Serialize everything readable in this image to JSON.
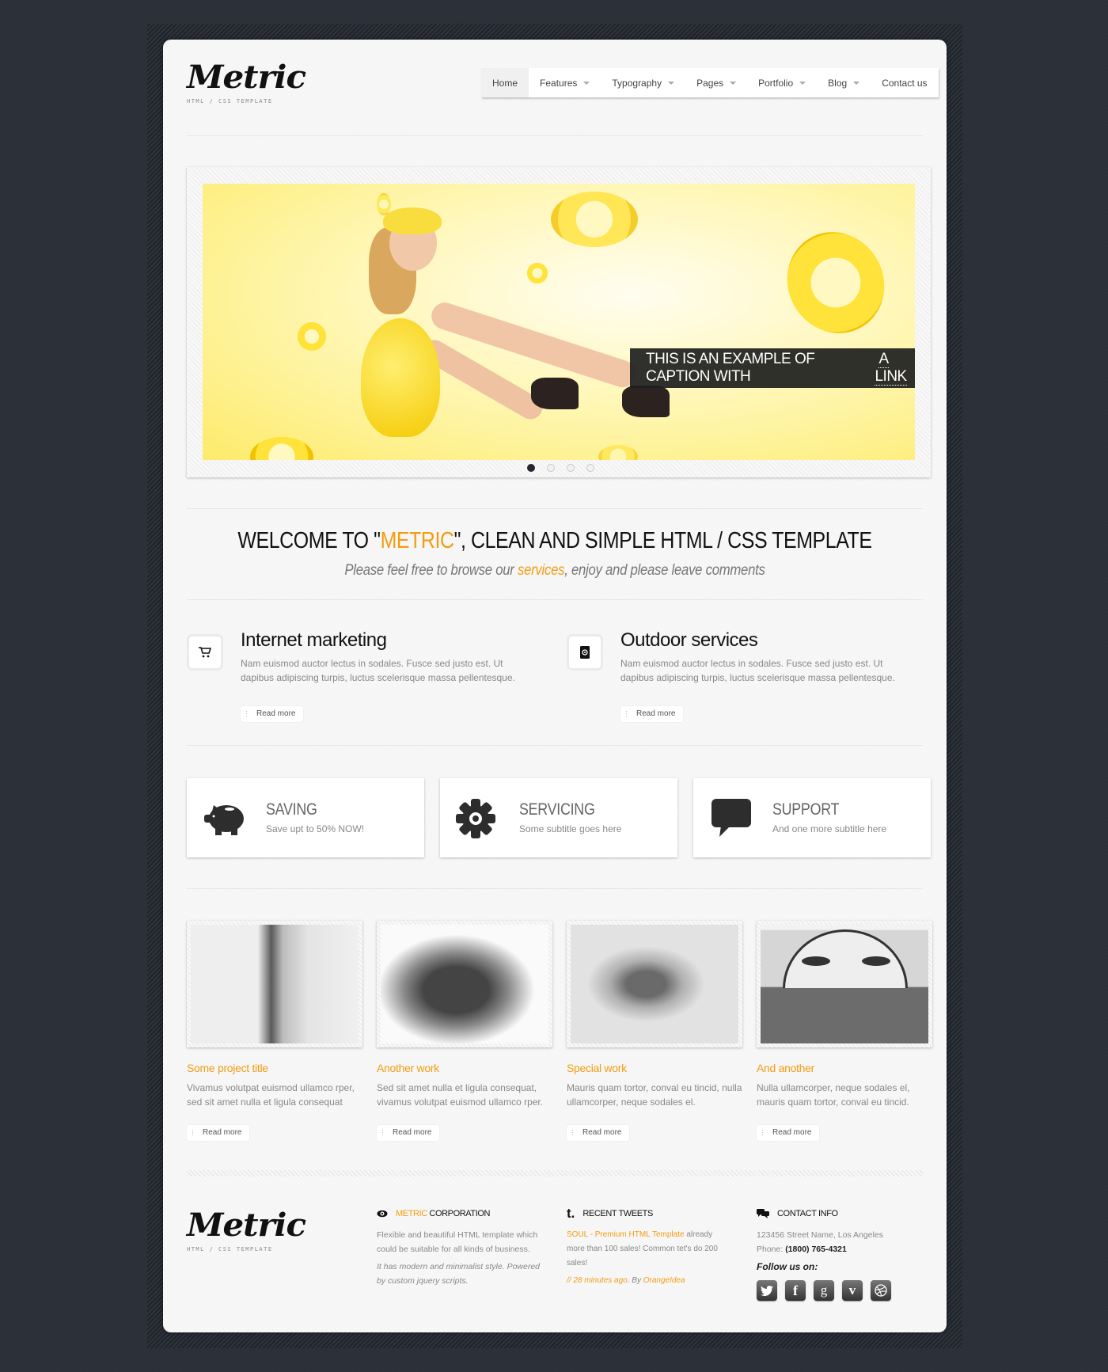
{
  "logo": {
    "title": "Metric",
    "subtitle": "HTML / CSS TEMPLATE"
  },
  "nav": {
    "items": [
      {
        "label": "Home",
        "active": true,
        "dropdown": false
      },
      {
        "label": "Features",
        "dropdown": true
      },
      {
        "label": "Typography",
        "dropdown": true
      },
      {
        "label": "Pages",
        "dropdown": true
      },
      {
        "label": "Portfolio",
        "dropdown": true
      },
      {
        "label": "Blog",
        "dropdown": true
      },
      {
        "label": "Contact us",
        "dropdown": false
      }
    ]
  },
  "slider": {
    "caption_text": "THIS IS AN EXAMPLE OF CAPTION WITH",
    "caption_link": "A LINK",
    "slide_count": 4,
    "active_slide": 1
  },
  "welcome": {
    "title_pre": "WELCOME TO \"",
    "title_highlight": "METRIC",
    "title_post": "\", CLEAN AND SIMPLE HTML / CSS TEMPLATE",
    "subtitle_pre": "Please feel free to browse our ",
    "subtitle_link": "services",
    "subtitle_post": ", enjoy and please leave comments"
  },
  "services": [
    {
      "icon": "shopping-cart-icon",
      "title": "Internet marketing",
      "text": "Nam euismod auctor lectus in sodales. Fusce sed justo est. Ut dapibus adipiscing turpis, luctus scelerisque massa pellentesque.",
      "button": "Read more"
    },
    {
      "icon": "address-book-icon",
      "title": "Outdoor services",
      "text": "Nam euismod auctor lectus in sodales. Fusce sed justo est. Ut dapibus adipiscing turpis, luctus scelerisque massa pellentesque.",
      "button": "Read more"
    }
  ],
  "features": [
    {
      "icon": "piggy-bank-icon",
      "title": "SAVING",
      "subtitle": "Save upt to 50% NOW!"
    },
    {
      "icon": "gear-icon",
      "title": "SERVICING",
      "subtitle": "Some subtitle goes here"
    },
    {
      "icon": "speech-bubble-icon",
      "title": "SUPPORT",
      "subtitle": "And one more subtitle here"
    }
  ],
  "portfolio": [
    {
      "title": "Some project title",
      "text": "Vivamus volutpat euismod ullamco rper, sed sit amet nulla et ligula consequat",
      "button": "Read more"
    },
    {
      "title": "Another work",
      "text": "Sed sit amet nulla et ligula consequat, vivamus volutpat euismod ullamco rper.",
      "button": "Read more"
    },
    {
      "title": "Special work",
      "text": "Mauris quam tortor, conval eu tincid, nulla ullamcorper, neque sodales el.",
      "button": "Read more"
    },
    {
      "title": "And another",
      "text": "Nulla ullamcorper, neque sodales el, mauris quam tortor, conval eu tincid.",
      "button": "Read more"
    }
  ],
  "footer": {
    "logo_title": "Metric",
    "logo_subtitle": "HTML / CSS TEMPLATE",
    "corporation": {
      "heading_highlight": "METRIC",
      "heading_rest": " CORPORATION",
      "text": "Flexible and beautiful HTML template which could be suitable for all kinds of business.",
      "italic": "It has modern and minimalist style. Powered by custom jquery scripts."
    },
    "tweets": {
      "heading": "RECENT TWEETS",
      "link": "SOUL - Premium HTML Template",
      "text": " already more than 100 sales! Common tet's do 200 sales!",
      "time": "// 28 minutes ago",
      "by": ". By ",
      "author": "OrangeIdea"
    },
    "contact": {
      "heading": "CONTACT INFO",
      "address": "123456 Street Name, Los Angeles",
      "phone_label": "Phone: ",
      "phone": "(1800) 765-4321",
      "follow": "Follow us on:",
      "social": [
        "twitter",
        "facebook",
        "google",
        "vimeo",
        "dribbble"
      ]
    }
  },
  "colors": {
    "accent": "#f39c12",
    "background": "#2b3038",
    "page": "#f7f7f7"
  }
}
